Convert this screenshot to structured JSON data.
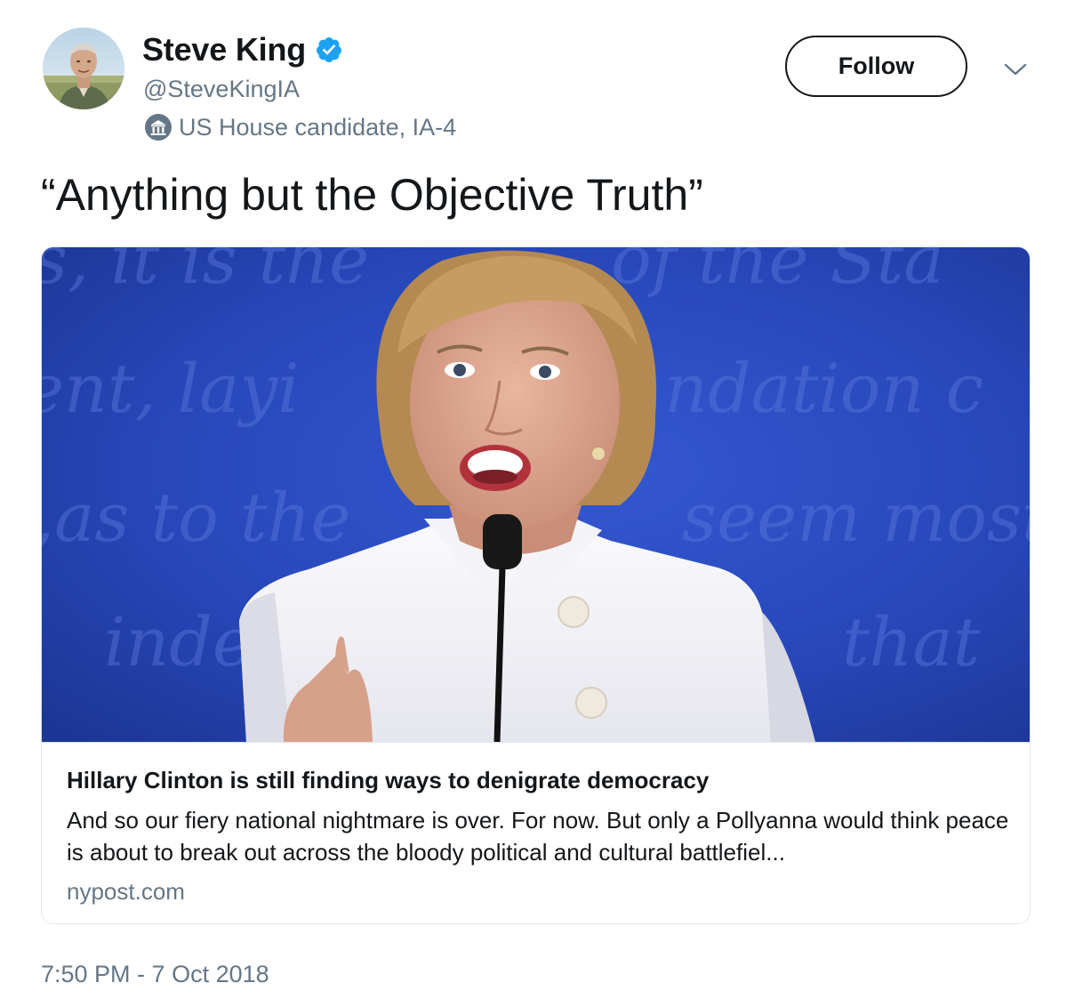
{
  "author": {
    "display_name": "Steve King",
    "handle": "@SteveKingIA",
    "verified": true,
    "account_label": "US House candidate, IA-4",
    "avatar_icon": "profile-photo",
    "label_icon": "government-building-icon"
  },
  "actions": {
    "follow_label": "Follow",
    "menu_icon": "chevron-down-icon"
  },
  "tweet": {
    "text": "“Anything but the Objective Truth”",
    "timestamp": "7:50 PM - 7 Oct 2018"
  },
  "card": {
    "image_description": "photo-of-speaker-at-microphone",
    "title": "Hillary Clinton is still finding ways to denigrate democracy",
    "description": "And so our fiery national nightmare is over. For now. But only a Pollyanna would think peace is about to break out across the bloody political and cultural battlefiel...",
    "domain": "nypost.com"
  },
  "colors": {
    "primary_text": "#14171a",
    "secondary_text": "#657786",
    "verified_blue": "#1da1f2",
    "border": "#e1e8ed",
    "photo_background_blue": "#2747b8"
  }
}
